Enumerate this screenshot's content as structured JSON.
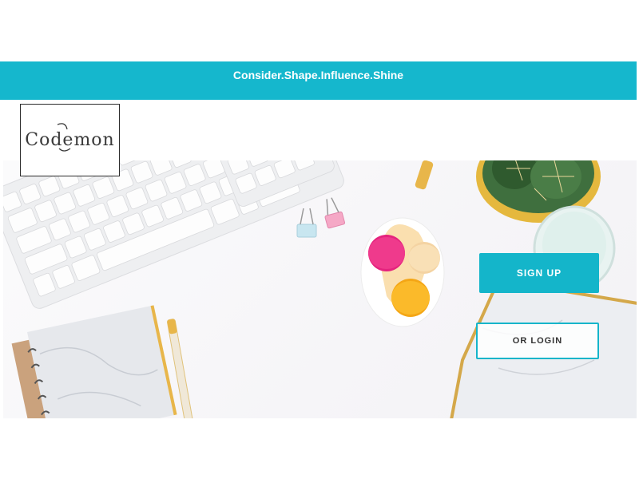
{
  "banner": {
    "tagline": "Consider.Shape.Influence.Shine"
  },
  "logo": {
    "text": "Codemon"
  },
  "actions": {
    "signup_label": "SIGN UP",
    "login_label": "OR LOGIN"
  },
  "colors": {
    "accent": "#15b7cd",
    "background": "#ffffff"
  }
}
